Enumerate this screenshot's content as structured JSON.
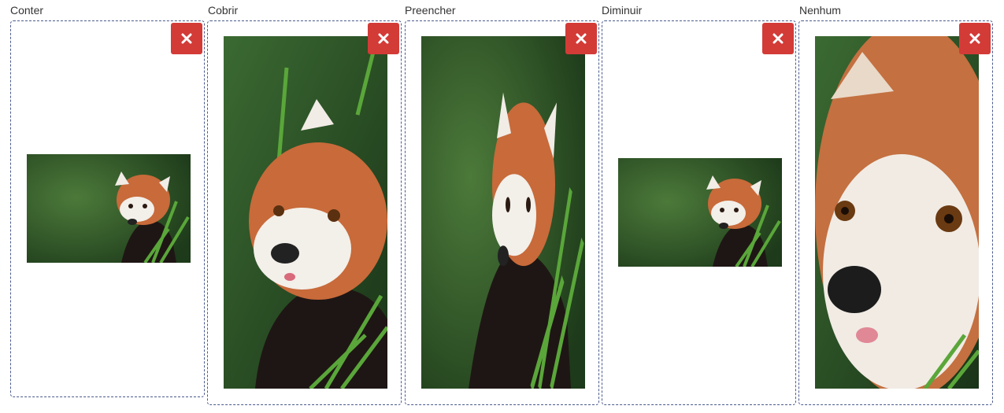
{
  "panels": [
    {
      "label": "Conter",
      "fit": "contain",
      "accent": "#d33b37"
    },
    {
      "label": "Cobrir",
      "fit": "cover",
      "accent": "#d33b37"
    },
    {
      "label": "Preencher",
      "fit": "fill",
      "accent": "#d33b37"
    },
    {
      "label": "Diminuir",
      "fit": "scale-down",
      "accent": "#d33b37"
    },
    {
      "label": "Nenhum",
      "fit": "none",
      "accent": "#d33b37"
    }
  ],
  "icons": {
    "remove": "close-icon",
    "photo": "red-panda-photo"
  }
}
